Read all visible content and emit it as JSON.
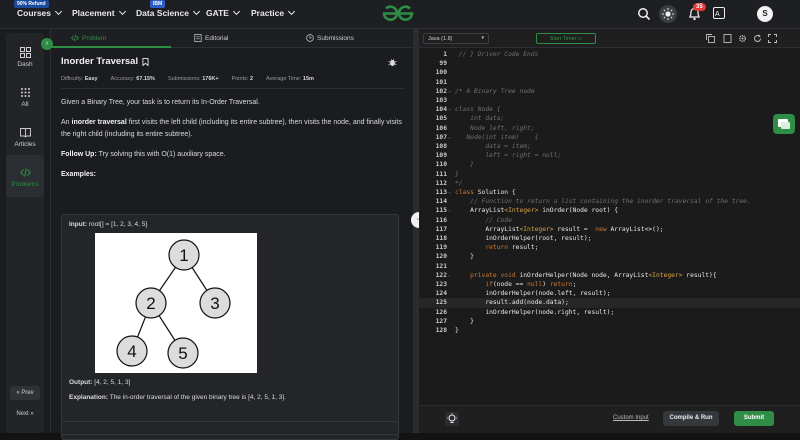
{
  "topbar": {
    "refund_badge": "90% Refund",
    "ibm_badge": "IBM",
    "nav": [
      "Courses",
      "Placement",
      "Data Science",
      "GATE",
      "Practice"
    ],
    "notifications_count": "35",
    "avatar_initial": "S"
  },
  "rail": {
    "items": [
      "Dash",
      "All",
      "Articles",
      "Problems"
    ],
    "prev": "« Prev",
    "next": "Next »"
  },
  "tabs": {
    "problem": "Problem",
    "editorial": "Editorial",
    "submissions": "Submissions"
  },
  "problem": {
    "title": "Inorder Traversal",
    "difficulty_label": "Difficulty:",
    "difficulty": "Easy",
    "accuracy_label": "Accuracy:",
    "accuracy": "67.15%",
    "submissions_label": "Submissions:",
    "submissions": "176K+",
    "points_label": "Points:",
    "points": "2",
    "avg_time_label": "Average Time:",
    "avg_time": "15m",
    "p1": "Given a Binary Tree, your task is to return its In-Order Traversal.",
    "p2_prefix": "An ",
    "p2_bold": "inorder traversal",
    "p2_rest": " first visits the left child (including its entire subtree), then visits the node, and finally visits the right child (including its entire subtree).",
    "followup_label": "Follow Up:",
    "followup": " Try solving this with O(1) auxiliary space.",
    "examples_label": "Examples:",
    "example": {
      "input_label": "Input:",
      "input": " root[] = [1, 2, 3, 4, 5]",
      "tree_nodes": [
        "1",
        "2",
        "3",
        "4",
        "5"
      ],
      "output_label": "Output:",
      "output": " [4, 2, 5, 1, 3]",
      "explanation_label": "Explanation:",
      "explanation": " The in-order traversal of the given binary tree is [4, 2, 5, 1, 3]."
    }
  },
  "editor": {
    "language": "Java (1.8)",
    "start_timer": "Start Timer",
    "custom_input": "Custom Input",
    "compile_run": "Compile & Run",
    "submit": "Submit",
    "lines": [
      {
        "n": "1",
        "t": " // } Driver Code Ends",
        "c": "cm"
      },
      {
        "n": "99",
        "t": "",
        "c": ""
      },
      {
        "n": "100",
        "t": "",
        "c": ""
      },
      {
        "n": "101",
        "t": "",
        "c": ""
      },
      {
        "n": "102",
        "t": "/* A Binary Tree node",
        "c": "cm"
      },
      {
        "n": "103",
        "t": "",
        "c": "cm"
      },
      {
        "n": "104",
        "t": "class Node {",
        "c": "cm"
      },
      {
        "n": "105",
        "t": "    int data;",
        "c": "cm"
      },
      {
        "n": "106",
        "t": "    Node left, right;",
        "c": "cm"
      },
      {
        "n": "107",
        "t": "   Node(int item)    {",
        "c": "cm"
      },
      {
        "n": "108",
        "t": "        data = item;",
        "c": "cm"
      },
      {
        "n": "109",
        "t": "        left = right = null;",
        "c": "cm"
      },
      {
        "n": "110",
        "t": "    }",
        "c": "cm"
      },
      {
        "n": "111",
        "t": "}",
        "c": "cm"
      },
      {
        "n": "112",
        "t": "*/",
        "c": "cm"
      },
      {
        "n": "113",
        "t": "class Solution {",
        "c": ""
      },
      {
        "n": "114",
        "t": "    // Function to return a list containing the inorder traversal of the tree.",
        "c": "cm"
      },
      {
        "n": "115",
        "t": "    ArrayList<Integer> inOrder(Node root) {",
        "c": ""
      },
      {
        "n": "116",
        "t": "        // Code",
        "c": "cm"
      },
      {
        "n": "117",
        "t": "        ArrayList<Integer> result =  new ArrayList<>();",
        "c": ""
      },
      {
        "n": "118",
        "t": "        inOrderHelper(root, result);",
        "c": ""
      },
      {
        "n": "119",
        "t": "        return result;",
        "c": ""
      },
      {
        "n": "120",
        "t": "    }",
        "c": ""
      },
      {
        "n": "121",
        "t": "",
        "c": ""
      },
      {
        "n": "122",
        "t": "    private void inOrderHelper(Node node, ArrayList<Integer> result){",
        "c": ""
      },
      {
        "n": "123",
        "t": "        if(node == null) return;",
        "c": ""
      },
      {
        "n": "124",
        "t": "        inOrderHelper(node.left, result);",
        "c": ""
      },
      {
        "n": "125",
        "t": "        result.add(node.data);",
        "c": "hl"
      },
      {
        "n": "126",
        "t": "        inOrderHelper(node.right, result);",
        "c": ""
      },
      {
        "n": "127",
        "t": "    }",
        "c": ""
      },
      {
        "n": "128",
        "t": "}",
        "c": ""
      }
    ]
  },
  "colors": {
    "accent": "#2f8d46",
    "bg": "#131313"
  }
}
